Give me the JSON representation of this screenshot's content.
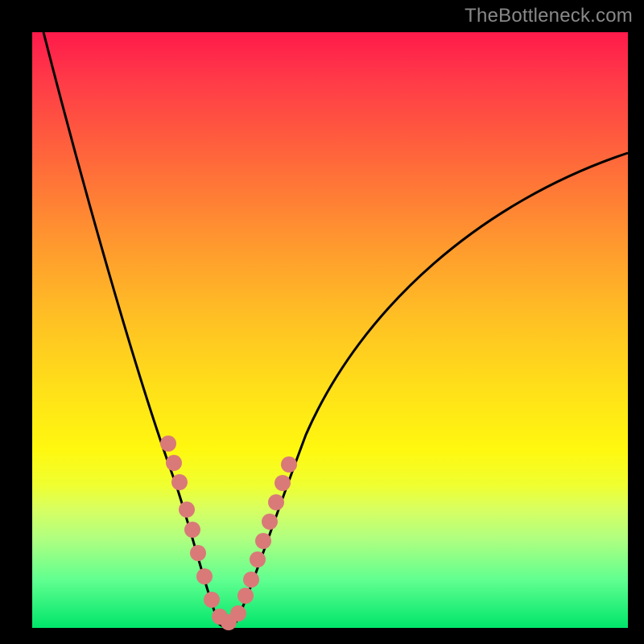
{
  "watermark": "TheBottleneck.com",
  "chart_data": {
    "type": "line",
    "title": "",
    "xlabel": "",
    "ylabel": "",
    "xlim": [
      0,
      100
    ],
    "ylim": [
      0,
      100
    ],
    "grid": false,
    "legend": false,
    "series": [
      {
        "name": "bottleneck-curve",
        "color": "#000000",
        "x": [
          2,
          5,
          8,
          11,
          14,
          17,
          20,
          22,
          24,
          26,
          27,
          28,
          29,
          30,
          31,
          32,
          33,
          34,
          36,
          38,
          40,
          43,
          46,
          50,
          55,
          60,
          65,
          70,
          75,
          80,
          85,
          90,
          95,
          100
        ],
        "y": [
          100,
          90,
          80,
          70,
          60,
          50,
          40,
          32,
          25,
          18,
          14,
          10,
          6,
          3,
          1,
          0,
          1,
          3,
          8,
          14,
          20,
          28,
          35,
          43,
          51,
          58,
          63,
          67,
          70,
          73,
          75,
          77,
          78.5,
          80
        ]
      },
      {
        "name": "highlight-dots",
        "color": "#d97a78",
        "type": "scatter",
        "x": [
          22.5,
          23.5,
          24.5,
          26,
          27,
          28,
          29,
          30.5,
          32,
          33.5,
          34.5,
          35.5,
          36.5,
          37.5,
          38.5,
          39.5,
          40.5,
          41.5,
          42.5
        ],
        "y": [
          31,
          27,
          23,
          17,
          13,
          9,
          5,
          2,
          1,
          2,
          5,
          8,
          11,
          14,
          17,
          20,
          23,
          26,
          29
        ]
      }
    ],
    "background": "rainbow-gradient-red-to-green-vertical"
  }
}
